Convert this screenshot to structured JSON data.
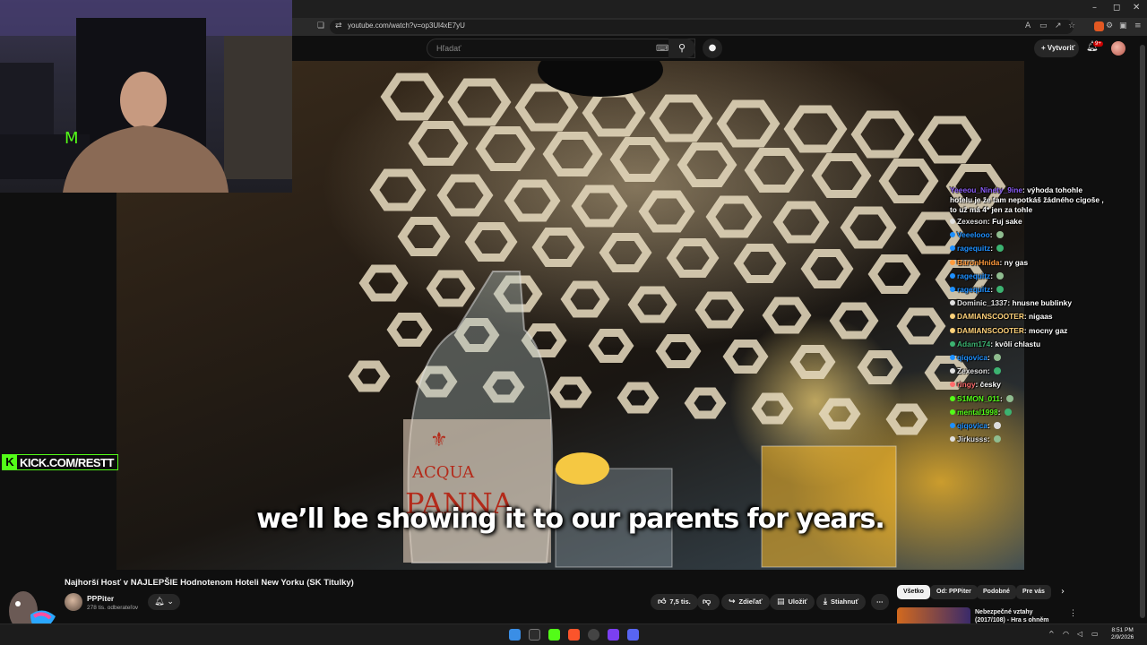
{
  "browser": {
    "url": "youtube.com/watch?v=op3Ul4xE7yU"
  },
  "youtube": {
    "search_placeholder": "Hľadať",
    "create_label": "Vytvoriť",
    "notifications_badge": "9+"
  },
  "video": {
    "subtitle": "we’ll be showing it to our parents for years.",
    "title": "Najhorší Hosť v NAJLEPŠIE Hodnotenom Hoteli New Yorku (SK Titulky)",
    "channel": "PPPiter",
    "subscribers": "278 tis. odberateľov",
    "likes": "7,5 tis.",
    "share_label": "Zdieľať",
    "save_label": "Uložiť",
    "download_label": "Stiahnuť"
  },
  "overlay": {
    "kick_logo": "K",
    "kick_text": "KICK.COM/RESTT"
  },
  "chat": [
    {
      "user": "Yeeeou_Ninety_9ine",
      "msg": "výhoda tohohle hotelu je že tam nepotkáš žádného cigoše , to už má 4* jen za tohle",
      "color": "#8a5cf6"
    },
    {
      "user": "Zexeson",
      "msg": "Fuj sake",
      "color": "#e0e0e0"
    },
    {
      "user": "Veeelooo",
      "msg": "",
      "color": "#1e90ff"
    },
    {
      "user": "ragequitz",
      "msg": "",
      "color": "#1e90ff"
    },
    {
      "user": "BaronHnida",
      "msg": "ny gas",
      "color": "#ff9a3c"
    },
    {
      "user": "ragequitz",
      "msg": "",
      "color": "#1e90ff"
    },
    {
      "user": "ragequitz",
      "msg": "",
      "color": "#1e90ff"
    },
    {
      "user": "Dominic_1337",
      "msg": "hnusne bublinky",
      "color": "#e0e0e0"
    },
    {
      "user": "DAMIANSCOOTER",
      "msg": "nigaas",
      "color": "#ffd27a"
    },
    {
      "user": "DAMIANSCOOTER",
      "msg": "mocny gaz",
      "color": "#ffd27a"
    },
    {
      "user": "Adam174",
      "msg": "kvôli chlastu",
      "color": "#3cb371"
    },
    {
      "user": "qiqovica",
      "msg": "",
      "color": "#1e90ff"
    },
    {
      "user": "Zexeson",
      "msg": "",
      "color": "#e0e0e0"
    },
    {
      "user": "ringy",
      "msg": "česky",
      "color": "#ff6b6b"
    },
    {
      "user": "S1MON_011",
      "msg": "",
      "color": "#53fc18"
    },
    {
      "user": "mental1998",
      "msg": "",
      "color": "#53fc18"
    },
    {
      "user": "qiqovica",
      "msg": "",
      "color": "#1e90ff"
    },
    {
      "user": "Jirkusss",
      "msg": "",
      "color": "#e0e0e0"
    }
  ],
  "chips": [
    {
      "label": "Všetko"
    },
    {
      "label": "Od: PPPiter"
    },
    {
      "label": "Podobné"
    },
    {
      "label": "Pre vás"
    }
  ],
  "recommended": {
    "title": "Nebezpečné vztahy (2017/108) - Hra s ohněm"
  },
  "taskbar": {
    "time": "8:51 PM",
    "date": "2/9/2026"
  }
}
